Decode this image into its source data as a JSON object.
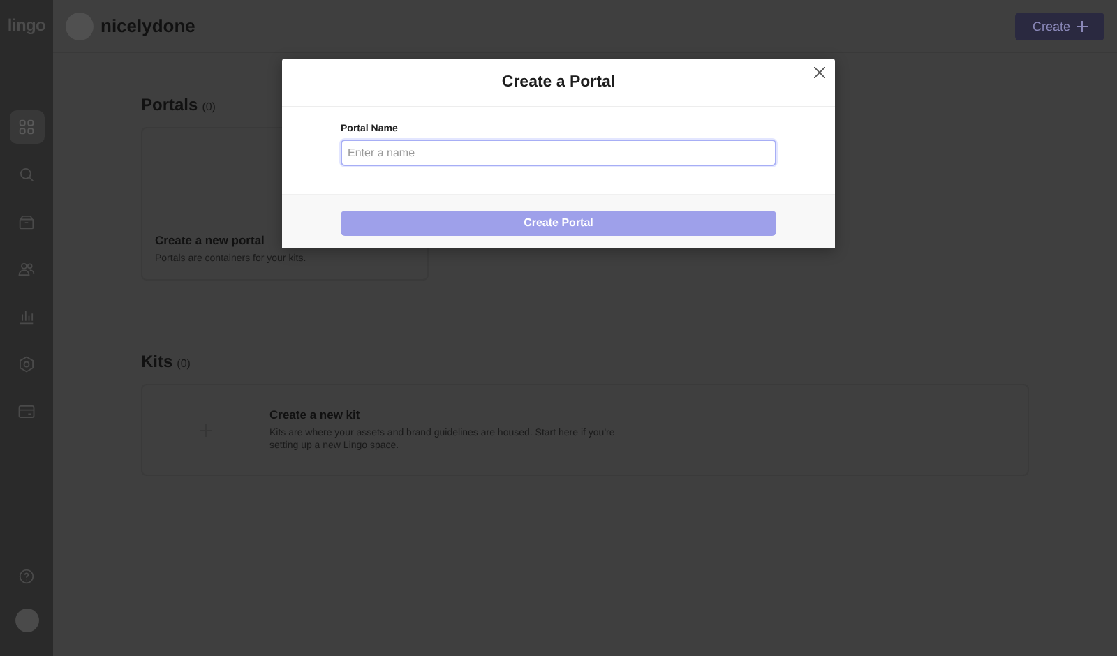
{
  "sidebar": {
    "logo": "lingo",
    "nav_items": [
      {
        "kind": "grid",
        "selected": true
      },
      {
        "kind": "search",
        "selected": false
      },
      {
        "kind": "box",
        "selected": false
      },
      {
        "kind": "users",
        "selected": false
      },
      {
        "kind": "chart",
        "selected": false
      },
      {
        "kind": "gear",
        "selected": false
      },
      {
        "kind": "card",
        "selected": false
      }
    ],
    "bottom_items": [
      {
        "kind": "help"
      },
      {
        "kind": "avatar"
      }
    ]
  },
  "header": {
    "workspace_name": "nicelydone",
    "create_button": "Create"
  },
  "sections": [
    {
      "kind": "portals",
      "title": "Portals",
      "count": "(0)",
      "card": {
        "title": "Create a new portal",
        "description": "Portals are containers for your kits."
      }
    },
    {
      "kind": "kits",
      "title": "Kits",
      "count": "(0)",
      "card": {
        "title": "Create a new kit",
        "description": "Kits are where your assets and brand guidelines are housed. Start here if you're setting up a new Lingo space."
      }
    }
  ],
  "modal": {
    "title": "Create a Portal",
    "field_label": "Portal Name",
    "placeholder": "Enter a name",
    "submit_button": "Create Portal"
  }
}
